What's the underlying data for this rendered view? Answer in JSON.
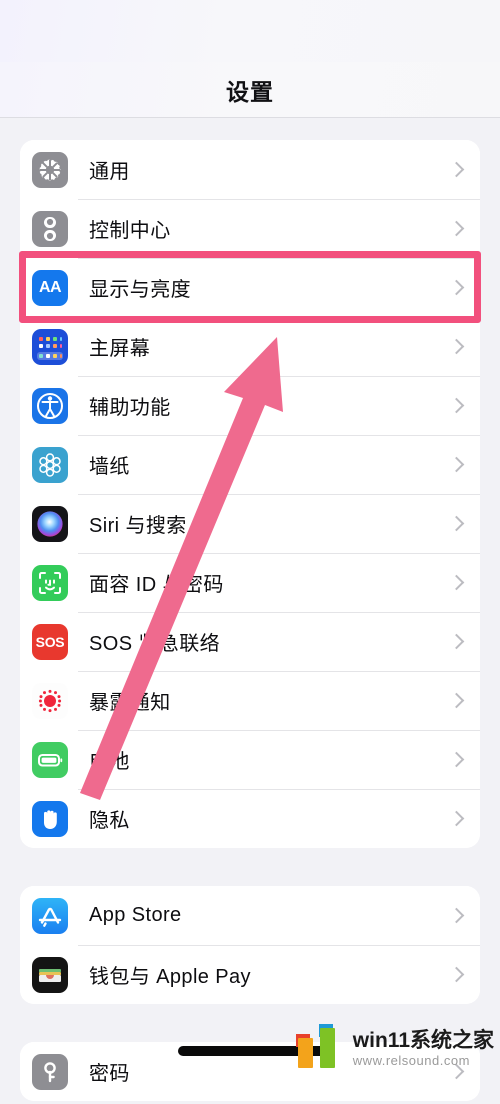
{
  "header": {
    "title": "设置"
  },
  "groups": [
    {
      "name": "main-settings-group",
      "rows": [
        {
          "label": "通用",
          "icon": "gear-icon"
        },
        {
          "label": "控制中心",
          "icon": "control-center-icon"
        },
        {
          "label": "显示与亮度",
          "icon": "display-brightness-icon",
          "highlighted": true
        },
        {
          "label": "主屏幕",
          "icon": "home-screen-icon"
        },
        {
          "label": "辅助功能",
          "icon": "accessibility-icon"
        },
        {
          "label": "墙纸",
          "icon": "wallpaper-icon"
        },
        {
          "label": "Siri 与搜索",
          "icon": "siri-icon"
        },
        {
          "label": "面容 ID 与密码",
          "icon": "face-id-icon"
        },
        {
          "label": "SOS 紧急联络",
          "icon": "sos-icon"
        },
        {
          "label": "暴露通知",
          "icon": "exposure-notification-icon"
        },
        {
          "label": "电池",
          "icon": "battery-icon"
        },
        {
          "label": "隐私",
          "icon": "privacy-hand-icon"
        }
      ]
    },
    {
      "name": "store-group",
      "rows": [
        {
          "label": "App Store",
          "icon": "app-store-icon"
        },
        {
          "label": "钱包与 Apple Pay",
          "icon": "wallet-icon"
        }
      ]
    },
    {
      "name": "passwords-group",
      "rows": [
        {
          "label": "密码",
          "icon": "passwords-key-icon"
        }
      ]
    }
  ],
  "annotation": {
    "highlight_color": "#f2507d",
    "arrow_color": "#ef6a8e",
    "target_label": "显示与亮度"
  },
  "watermark": {
    "brand": "win11系统之家",
    "url": "www.relsound.com",
    "logo_colors": {
      "orange": "#f3a31b",
      "green": "#7ec225",
      "red": "#e8412b",
      "blue": "#1e9ad6"
    }
  }
}
